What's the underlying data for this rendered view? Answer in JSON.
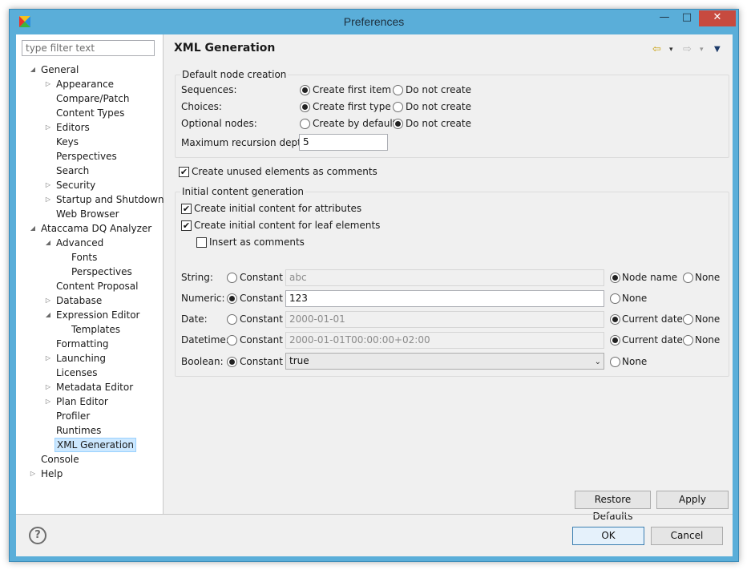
{
  "window": {
    "title": "Preferences",
    "min_symbol": "—",
    "max_symbol": "□",
    "close_symbol": "✕"
  },
  "filter": {
    "placeholder": "type filter text"
  },
  "tree": [
    {
      "label": "General",
      "level": 0,
      "twisty": "◢"
    },
    {
      "label": "Appearance",
      "level": 1,
      "twisty": "▷"
    },
    {
      "label": "Compare/Patch",
      "level": 1,
      "twisty": ""
    },
    {
      "label": "Content Types",
      "level": 1,
      "twisty": ""
    },
    {
      "label": "Editors",
      "level": 1,
      "twisty": "▷"
    },
    {
      "label": "Keys",
      "level": 1,
      "twisty": ""
    },
    {
      "label": "Perspectives",
      "level": 1,
      "twisty": ""
    },
    {
      "label": "Search",
      "level": 1,
      "twisty": ""
    },
    {
      "label": "Security",
      "level": 1,
      "twisty": "▷"
    },
    {
      "label": "Startup and Shutdown",
      "level": 1,
      "twisty": "▷"
    },
    {
      "label": "Web Browser",
      "level": 1,
      "twisty": ""
    },
    {
      "label": "Ataccama DQ Analyzer",
      "level": 0,
      "twisty": "◢"
    },
    {
      "label": "Advanced",
      "level": 1,
      "twisty": "◢"
    },
    {
      "label": "Fonts",
      "level": 2,
      "twisty": ""
    },
    {
      "label": "Perspectives",
      "level": 2,
      "twisty": ""
    },
    {
      "label": "Content Proposal",
      "level": 1,
      "twisty": ""
    },
    {
      "label": "Database",
      "level": 1,
      "twisty": "▷"
    },
    {
      "label": "Expression Editor",
      "level": 1,
      "twisty": "◢"
    },
    {
      "label": "Templates",
      "level": 2,
      "twisty": ""
    },
    {
      "label": "Formatting",
      "level": 1,
      "twisty": ""
    },
    {
      "label": "Launching",
      "level": 1,
      "twisty": "▷"
    },
    {
      "label": "Licenses",
      "level": 1,
      "twisty": ""
    },
    {
      "label": "Metadata Editor",
      "level": 1,
      "twisty": "▷"
    },
    {
      "label": "Plan Editor",
      "level": 1,
      "twisty": "▷"
    },
    {
      "label": "Profiler",
      "level": 1,
      "twisty": ""
    },
    {
      "label": "Runtimes",
      "level": 1,
      "twisty": ""
    },
    {
      "label": "XML Generation",
      "level": 1,
      "twisty": "",
      "selected": true
    },
    {
      "label": "Console",
      "level": 0,
      "twisty": ""
    },
    {
      "label": "Help",
      "level": 0,
      "twisty": "▷"
    }
  ],
  "page": {
    "title": "XML Generation",
    "nav": {
      "back": "⇦",
      "forward": "⇨",
      "dropdown": "▾",
      "menu": "▼"
    }
  },
  "default_node": {
    "legend": "Default node creation",
    "sequences_label": "Sequences:",
    "choices_label": "Choices:",
    "optional_label": "Optional nodes:",
    "create_first_item": "Create first item",
    "create_first_type": "Create first type",
    "create_by_default": "Create by default",
    "do_not_create": "Do not create",
    "max_depth_label": "Maximum recursion depth:",
    "max_depth_value": "5",
    "sequences_choice": "create",
    "choices_choice": "create",
    "optional_choice": "do_not_create"
  },
  "unused_comments": {
    "label": "Create unused elements as comments",
    "checked": true
  },
  "initial_content": {
    "legend": "Initial content generation",
    "attributes": {
      "label": "Create initial content for attributes",
      "checked": true
    },
    "leaf": {
      "label": "Create initial content for leaf elements",
      "checked": true
    },
    "insert_comments": {
      "label": "Insert as comments",
      "checked": false
    },
    "constant_label": "Constant",
    "none_label": "None",
    "node_name_label": "Node name",
    "current_date_label": "Current date",
    "rows": {
      "string": {
        "label": "String:",
        "value": "abc"
      },
      "numeric": {
        "label": "Numeric:",
        "value": "123"
      },
      "date": {
        "label": "Date:",
        "value": "2000-01-01"
      },
      "datetime": {
        "label": "Datetime:",
        "value": "2000-01-01T00:00:00+02:00"
      },
      "boolean": {
        "label": "Boolean:",
        "value": "true"
      }
    }
  },
  "buttons": {
    "restore_defaults": "Restore Defaults",
    "apply": "Apply",
    "ok": "OK",
    "cancel": "Cancel",
    "help": "?"
  }
}
